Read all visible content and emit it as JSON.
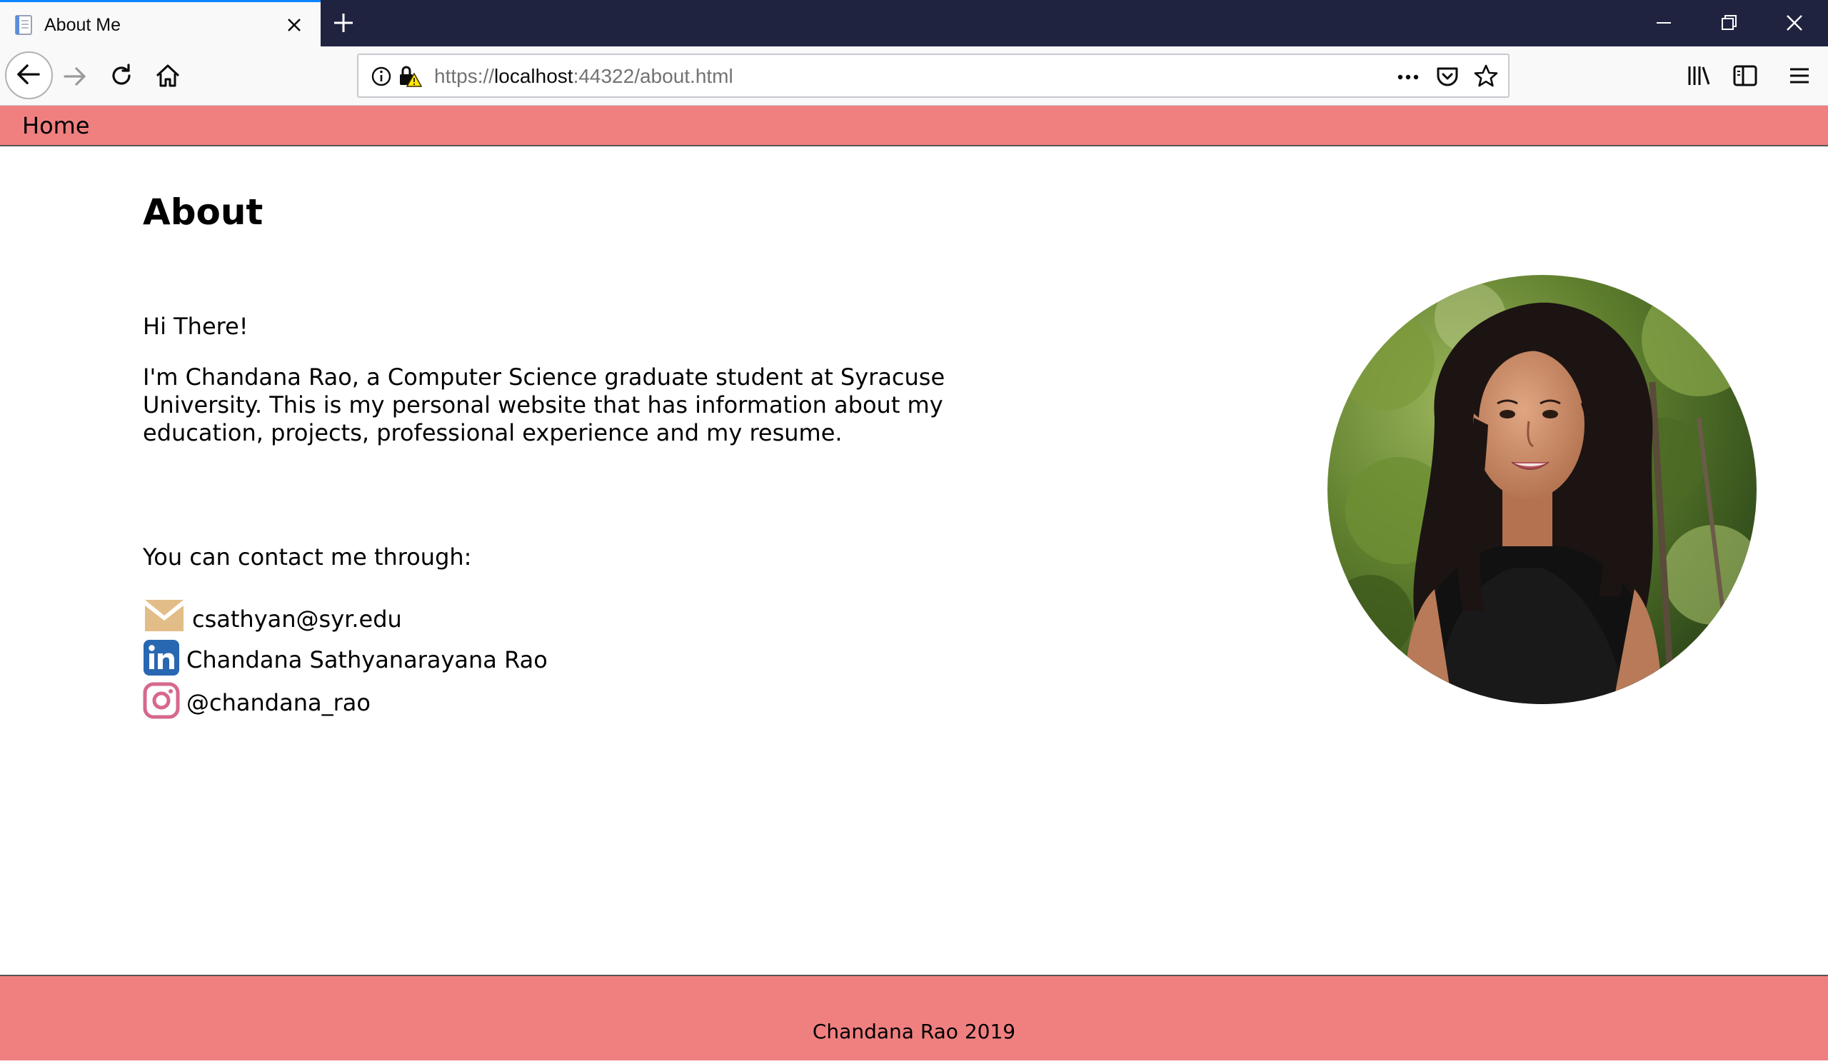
{
  "browser": {
    "tab": {
      "title": "About Me"
    },
    "url": {
      "scheme": "https://",
      "host": "localhost",
      "rest": ":44322/about.html"
    }
  },
  "header": {
    "home_label": "Home"
  },
  "main": {
    "title": "About",
    "greeting": "Hi There!",
    "intro": "I'm Chandana Rao, a Computer Science graduate student at Syracuse University. This is my personal website that has information about my education, projects, professional experience and my resume.",
    "contact_heading": "You can contact me through:",
    "contacts": [
      {
        "icon": "envelope-icon",
        "text": "csathyan@syr.edu",
        "color": "#e2bd87"
      },
      {
        "icon": "linkedin-icon",
        "text": "Chandana Sathyanarayana Rao",
        "color": "#2867b2"
      },
      {
        "icon": "instagram-icon",
        "text": "@chandana_rao",
        "color": "#d6688e"
      }
    ]
  },
  "footer": {
    "text": "Chandana Rao 2019"
  },
  "colors": {
    "accent": "#f08080",
    "browser_frame": "#202340",
    "tab_highlight": "#0a84ff"
  }
}
